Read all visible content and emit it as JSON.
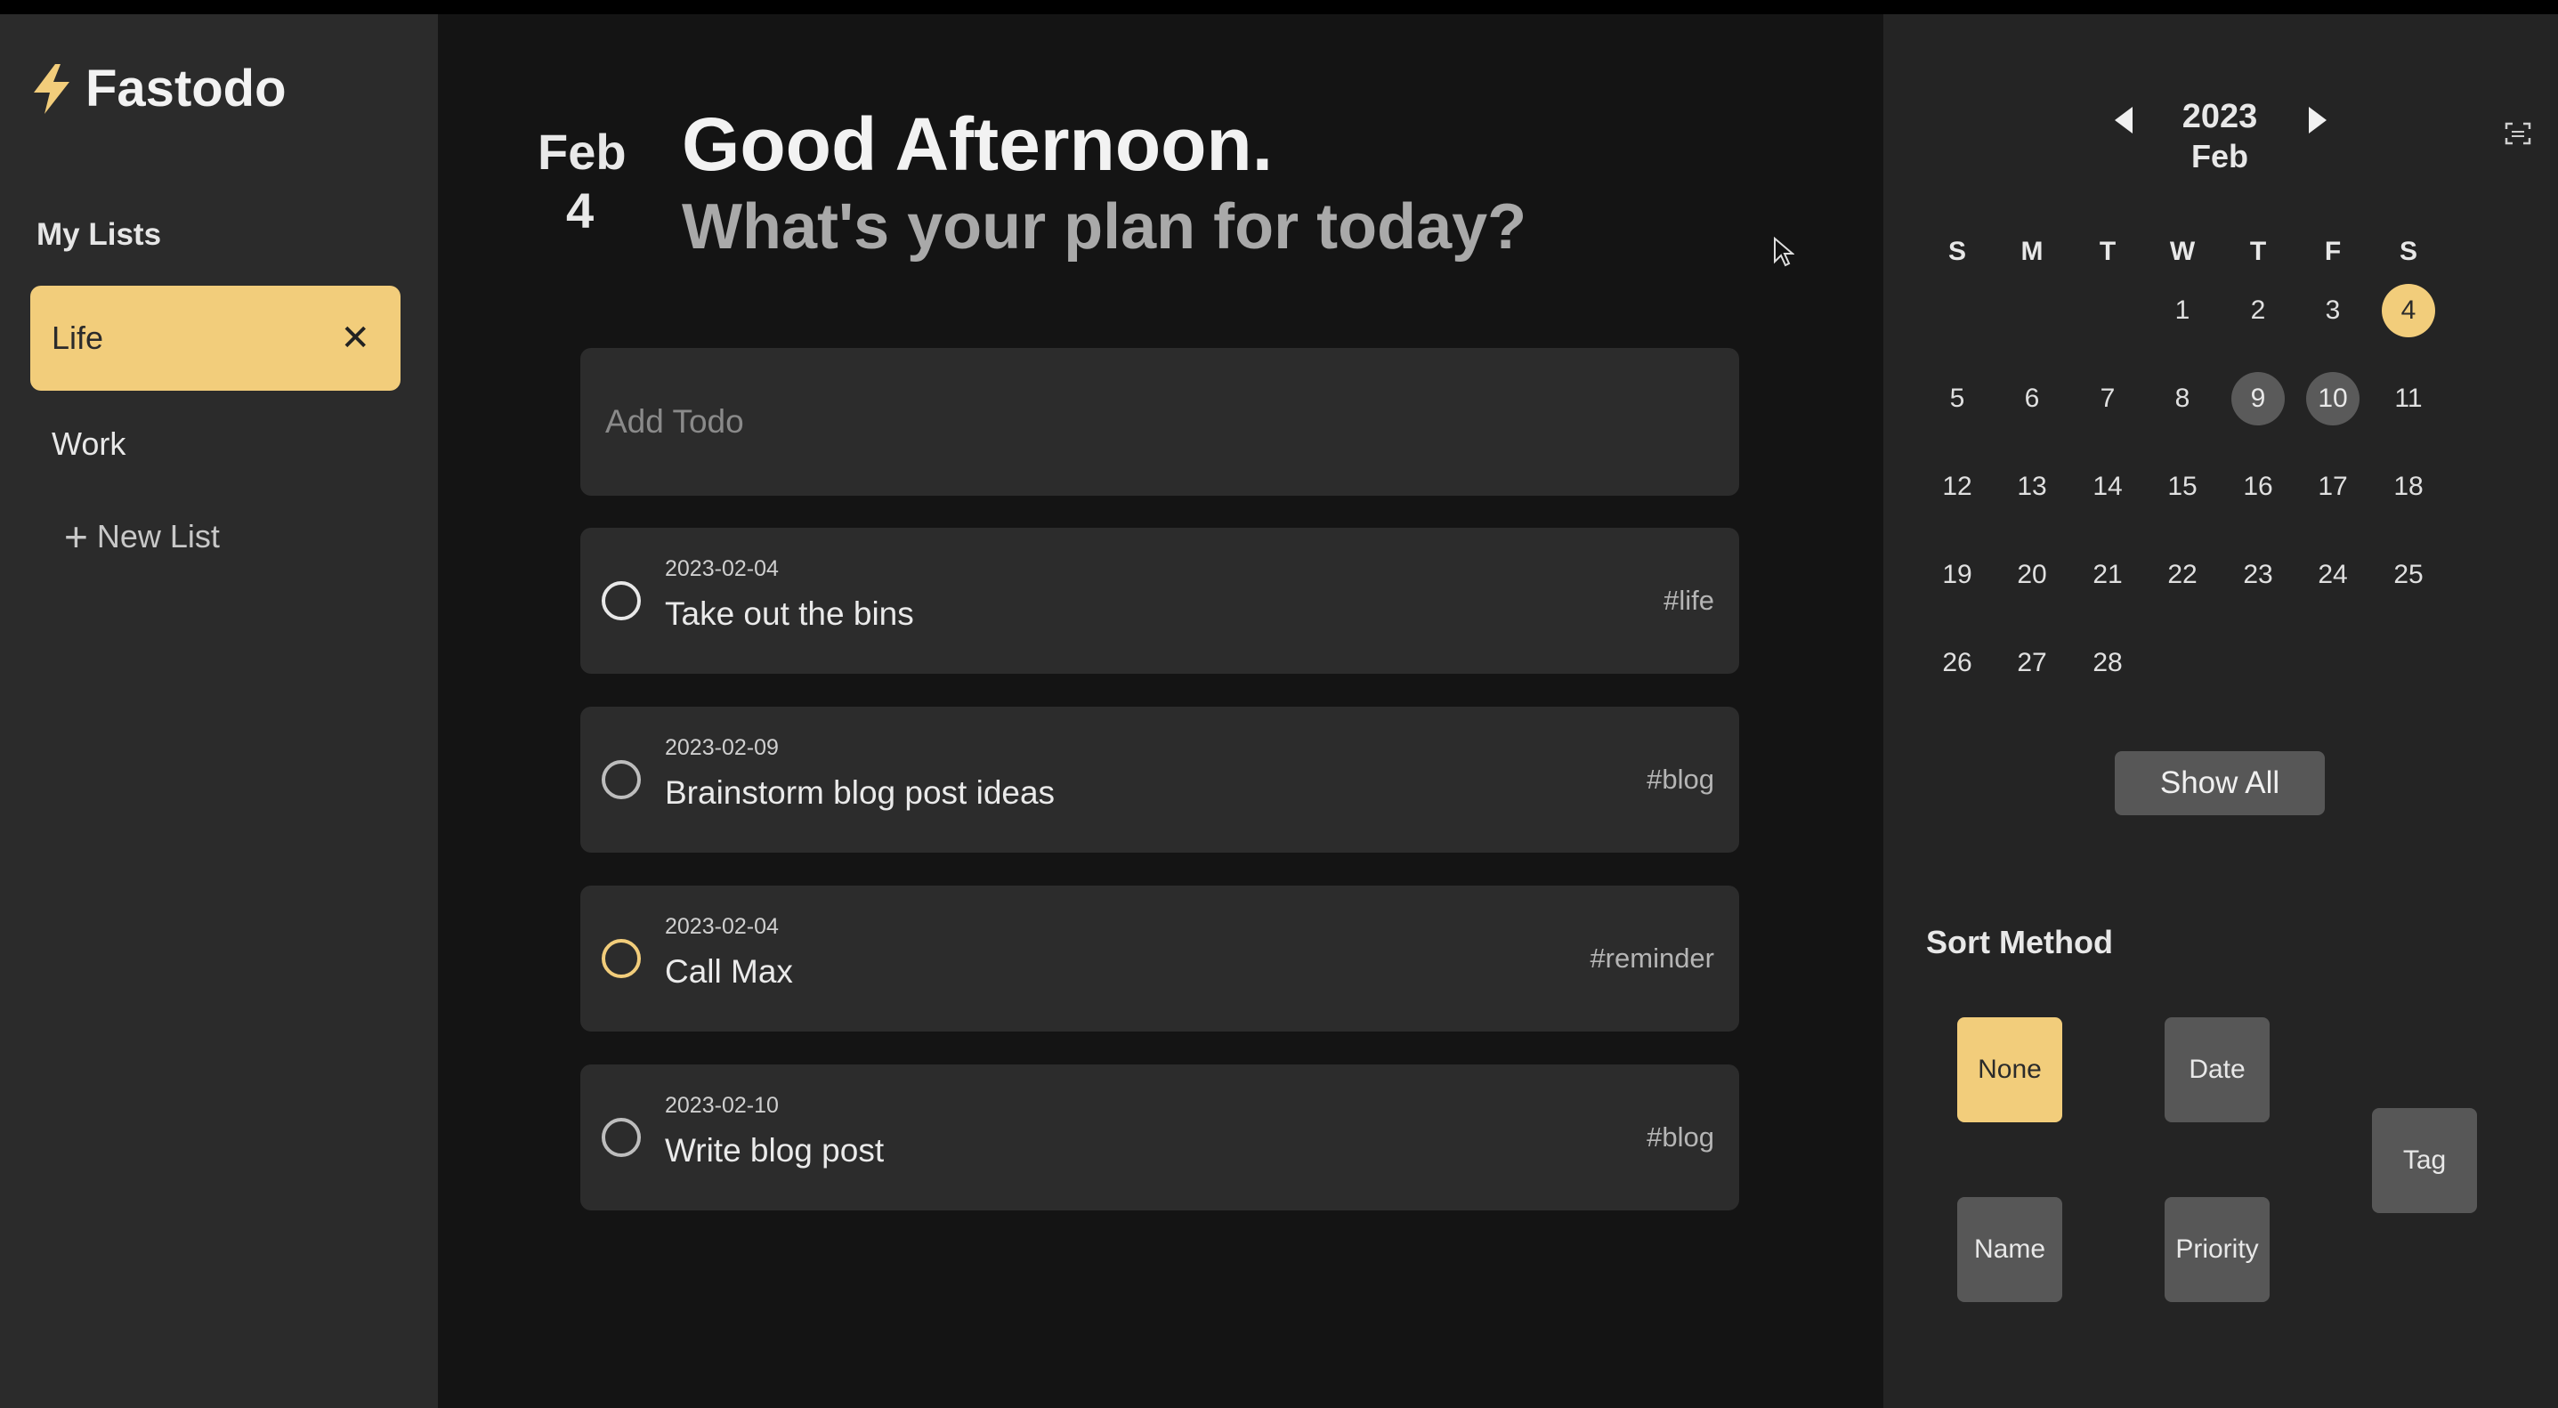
{
  "app": {
    "name": "Fastodo",
    "logo_icon": "lightning-bolt-icon",
    "accent": "#f2cd7b"
  },
  "sidebar": {
    "heading": "My Lists",
    "lists": [
      {
        "label": "Life",
        "active": true,
        "close": "✕"
      },
      {
        "label": "Work",
        "active": false
      }
    ],
    "new_list": {
      "icon": "+",
      "label": "New List"
    }
  },
  "header": {
    "month": "Feb",
    "day": "4",
    "greeting": "Good Afternoon.",
    "subtitle": "What's your plan for today?"
  },
  "add_todo": {
    "placeholder": "Add Todo",
    "value": ""
  },
  "todos": [
    {
      "date": "2023-02-04",
      "title": "Take out the bins",
      "tag": "#life",
      "circle": "white"
    },
    {
      "date": "2023-02-09",
      "title": "Brainstorm blog post ideas",
      "tag": "#blog",
      "circle": "grey"
    },
    {
      "date": "2023-02-04",
      "title": "Call Max",
      "tag": "#reminder",
      "circle": "yellow"
    },
    {
      "date": "2023-02-10",
      "title": "Write blog post",
      "tag": "#blog",
      "circle": "grey"
    }
  ],
  "calendar": {
    "year": "2023",
    "month": "Feb",
    "weekdays": [
      "S",
      "M",
      "T",
      "W",
      "T",
      "F",
      "S"
    ],
    "first_weekday_index": 3,
    "days_in_month": 28,
    "today": 4,
    "days_with_todos": [
      9,
      10
    ],
    "show_all": "Show All"
  },
  "sort": {
    "title": "Sort Method",
    "options": {
      "none": "None",
      "date": "Date",
      "tag": "Tag",
      "name": "Name",
      "priority": "Priority"
    },
    "selected": "None"
  }
}
